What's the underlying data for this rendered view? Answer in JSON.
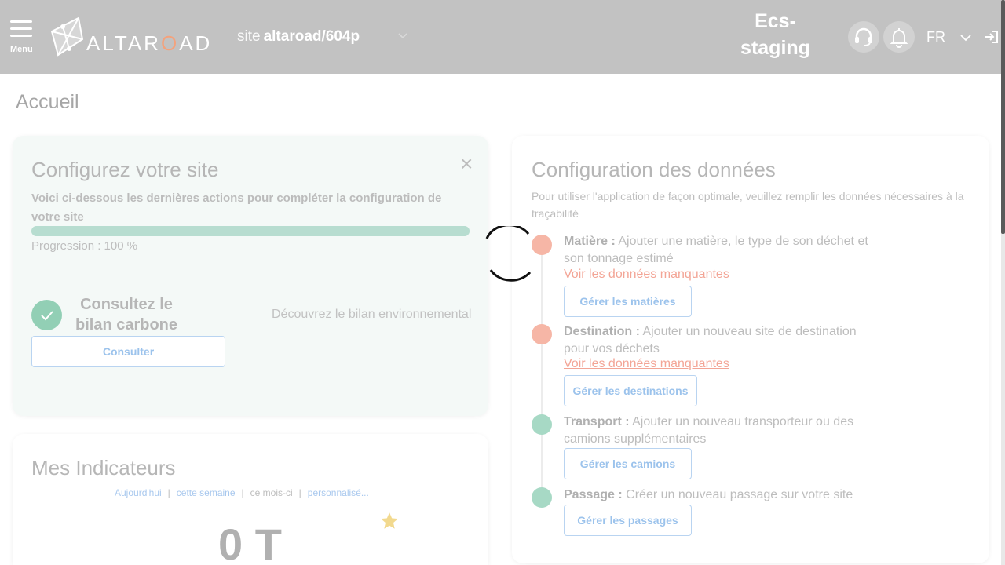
{
  "header": {
    "menu_label": "Menu",
    "logo_text_before": "ALTAR",
    "logo_text_o": "O",
    "logo_text_after": "AD",
    "site_prefix": "site",
    "site_name": "altaroad/604p",
    "env_line1": "Ecs-",
    "env_line2": "staging",
    "language": "FR",
    "icons": [
      "menu-icon",
      "altaroad-logo",
      "chevron-down-icon",
      "headset-icon",
      "bell-icon",
      "chevron-down-icon",
      "logout-icon"
    ]
  },
  "page": {
    "title": "Accueil"
  },
  "config_card": {
    "title": "Configurez votre site",
    "close": "×",
    "description": "Voici ci-dessous les dernières actions pour compléter la configuration de votre site",
    "progress_percent": 100,
    "progress_text": "Progression : 100 %",
    "bilan_title": "Consultez le bilan carbone",
    "bilan_desc": "Découvrez le bilan environnemental",
    "consult_button": "Consulter"
  },
  "indicators_card": {
    "title": "Mes Indicateurs",
    "periods": [
      "Aujourd'hui",
      "cette semaine",
      "ce mois-ci",
      "personnalisé..."
    ],
    "active_period_index": 2,
    "value": "0 T"
  },
  "data_card": {
    "title": "Configuration des données",
    "description": "Pour utiliser l'application de façon optimale, veuillez remplir les données nécessaires à la traçabilité",
    "steps": [
      {
        "label": "Matière :",
        "text": " Ajouter une matière, le type de son déchet et son tonnage estimé",
        "missing": "Voir les données manquantes",
        "button": "Gérer les matières",
        "status": "incomplete"
      },
      {
        "label": "Destination :",
        "text": " Ajouter un nouveau site de destination pour vos déchets",
        "missing": "Voir les données manquantes",
        "button": "Gérer les destinations",
        "status": "incomplete"
      },
      {
        "label": "Transport :",
        "text": " Ajouter un nouveau transporteur ou des camions supplémentaires",
        "button": "Gérer les camions",
        "status": "complete"
      },
      {
        "label": "Passage :",
        "text": " Créer un nouveau passage sur votre site",
        "button": "Gérer les passages",
        "status": "complete"
      }
    ]
  },
  "colors": {
    "header_bg": "#c2c2c2",
    "accent_orange": "#f4a27c",
    "incomplete_red": "#f6b6a6",
    "complete_green": "#a7d9c5",
    "button_blue": "#9cc3ec"
  }
}
